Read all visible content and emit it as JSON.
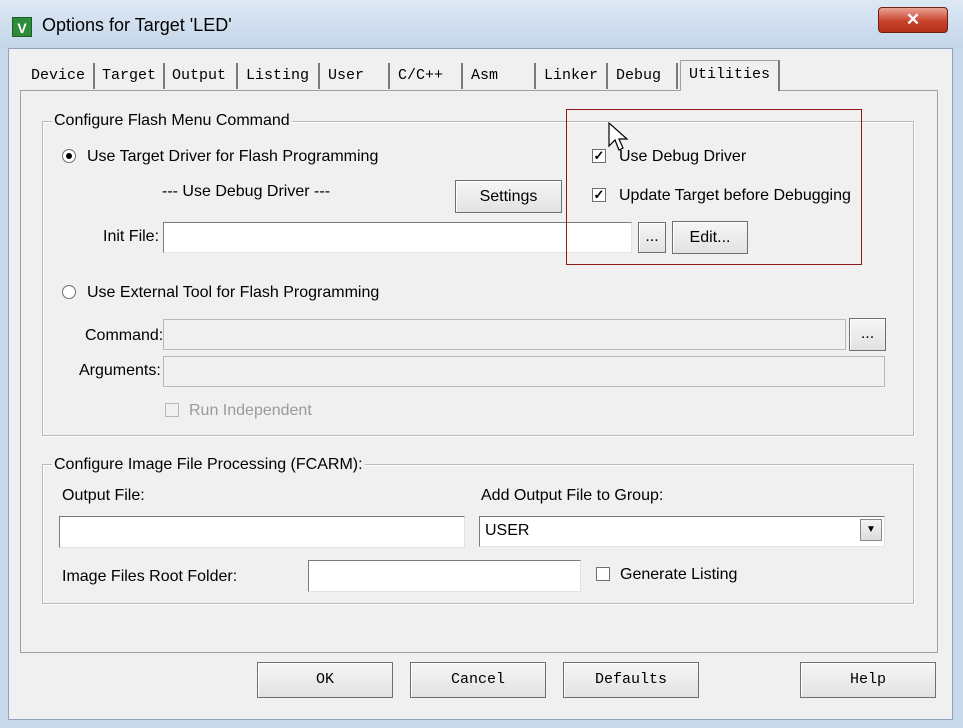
{
  "window": {
    "title": "Options for Target 'LED'",
    "app_icon_letter": "V",
    "close_symbol": "✕"
  },
  "tabs": [
    "Device",
    "Target",
    "Output",
    "Listing",
    "User",
    "C/C++",
    "Asm",
    "Linker",
    "Debug",
    "Utilities"
  ],
  "active_tab": "Utilities",
  "flash_menu": {
    "legend": "Configure Flash Menu Command",
    "use_target_driver_label": "Use Target Driver for Flash Programming",
    "use_target_driver_selected": true,
    "driver_value": "--- Use Debug Driver ---",
    "settings_label": "Settings",
    "init_file_label": "Init File:",
    "init_file_value": "",
    "browse_label": "...",
    "edit_label": "Edit...",
    "use_debug_driver_label": "Use Debug Driver",
    "use_debug_driver_checked": true,
    "update_target_label": "Update Target before Debugging",
    "update_target_checked": true,
    "use_external_tool_label": "Use External Tool for Flash Programming",
    "use_external_tool_selected": false,
    "command_label": "Command:",
    "command_value": "",
    "command_browse_label": "...",
    "arguments_label": "Arguments:",
    "arguments_value": "",
    "run_independent_label": "Run Independent",
    "run_independent_checked": false
  },
  "image_processing": {
    "legend": "Configure Image File Processing (FCARM):",
    "output_file_label": "Output File:",
    "output_file_value": "",
    "add_output_group_label": "Add Output File  to Group:",
    "group_value": "USER",
    "root_folder_label": "Image Files Root Folder:",
    "root_folder_value": "",
    "generate_listing_label": "Generate Listing",
    "generate_listing_checked": false
  },
  "footer": {
    "ok": "OK",
    "cancel": "Cancel",
    "defaults": "Defaults",
    "help": "Help"
  },
  "colors": {
    "highlight_border": "#8b1a1a",
    "close_button": "#c8432a",
    "app_icon": "#2e8b3a"
  }
}
